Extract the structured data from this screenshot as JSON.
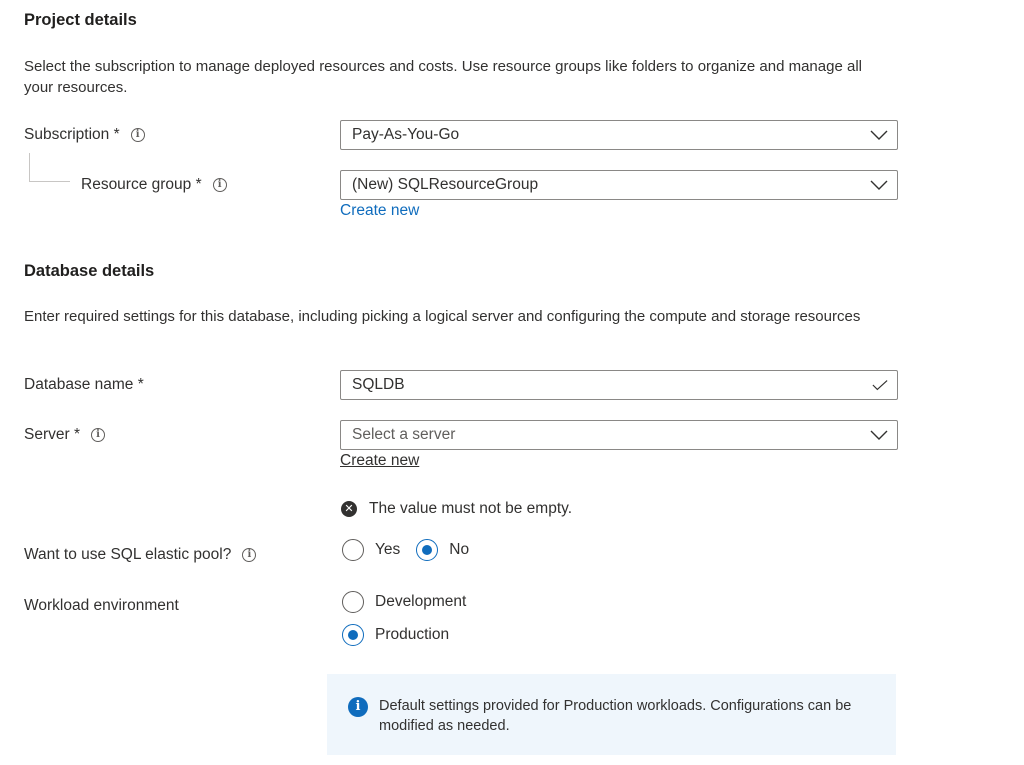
{
  "project": {
    "title": "Project details",
    "description": "Select the subscription to manage deployed resources and costs. Use resource groups like folders to organize and manage all your resources.",
    "subscription_label": "Subscription *",
    "subscription_value": "Pay-As-You-Go",
    "resource_group_label": "Resource group *",
    "resource_group_value": "(New) SQLResourceGroup",
    "create_new_link": "Create new"
  },
  "database": {
    "title": "Database details",
    "description": "Enter required settings for this database, including picking a logical server and configuring the compute and storage resources",
    "name_label": "Database name *",
    "name_value": "SQLDB",
    "server_label": "Server *",
    "server_placeholder": "Select a server",
    "server_create_new": "Create new",
    "server_error": "The value must not be empty.",
    "elastic_pool_label": "Want to use SQL elastic pool?",
    "elastic_pool_options": [
      "Yes",
      "No"
    ],
    "elastic_pool_selected": "No",
    "workload_label": "Workload environment",
    "workload_options": [
      "Development",
      "Production"
    ],
    "workload_selected": "Production",
    "info_message": "Default settings provided for Production workloads. Configurations can be modified as needed."
  },
  "icons": {
    "info": "info-icon",
    "chevron": "chevron-down-icon",
    "check": "checkmark-icon",
    "error": "error-icon"
  },
  "colors": {
    "accent": "#0f6cbd",
    "info_bg": "#eff6fc",
    "border": "#8a8886"
  }
}
